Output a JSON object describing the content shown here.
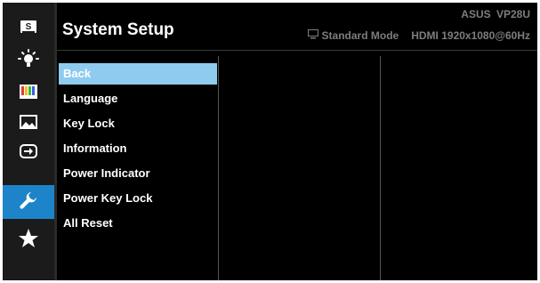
{
  "header": {
    "title": "System Setup",
    "model": "ASUS  VP28U",
    "mode": "Standard Mode",
    "signal": "HDMI 1920x1080@60Hz",
    "mode_icon": "monitor-icon"
  },
  "sidebar": {
    "items": [
      {
        "icon": "splendid-s-icon",
        "active": false
      },
      {
        "icon": "brightness-icon",
        "active": false
      },
      {
        "icon": "color-bars-icon",
        "active": false
      },
      {
        "icon": "image-icon",
        "active": false
      },
      {
        "icon": "input-select-icon",
        "active": false
      },
      {
        "icon": "wrench-icon",
        "active": true
      },
      {
        "icon": "star-icon",
        "active": false
      }
    ]
  },
  "menu": {
    "items": [
      {
        "label": "Back",
        "selected": true
      },
      {
        "label": "Language"
      },
      {
        "label": "Key Lock"
      },
      {
        "label": "Information"
      },
      {
        "label": "Power Indicator"
      },
      {
        "label": "Power Key Lock"
      },
      {
        "label": "All Reset"
      }
    ]
  },
  "colors": {
    "accent": "#1e84c9",
    "selection": "#8ecbef",
    "background": "#000000",
    "rail": "#1b1b1b"
  }
}
